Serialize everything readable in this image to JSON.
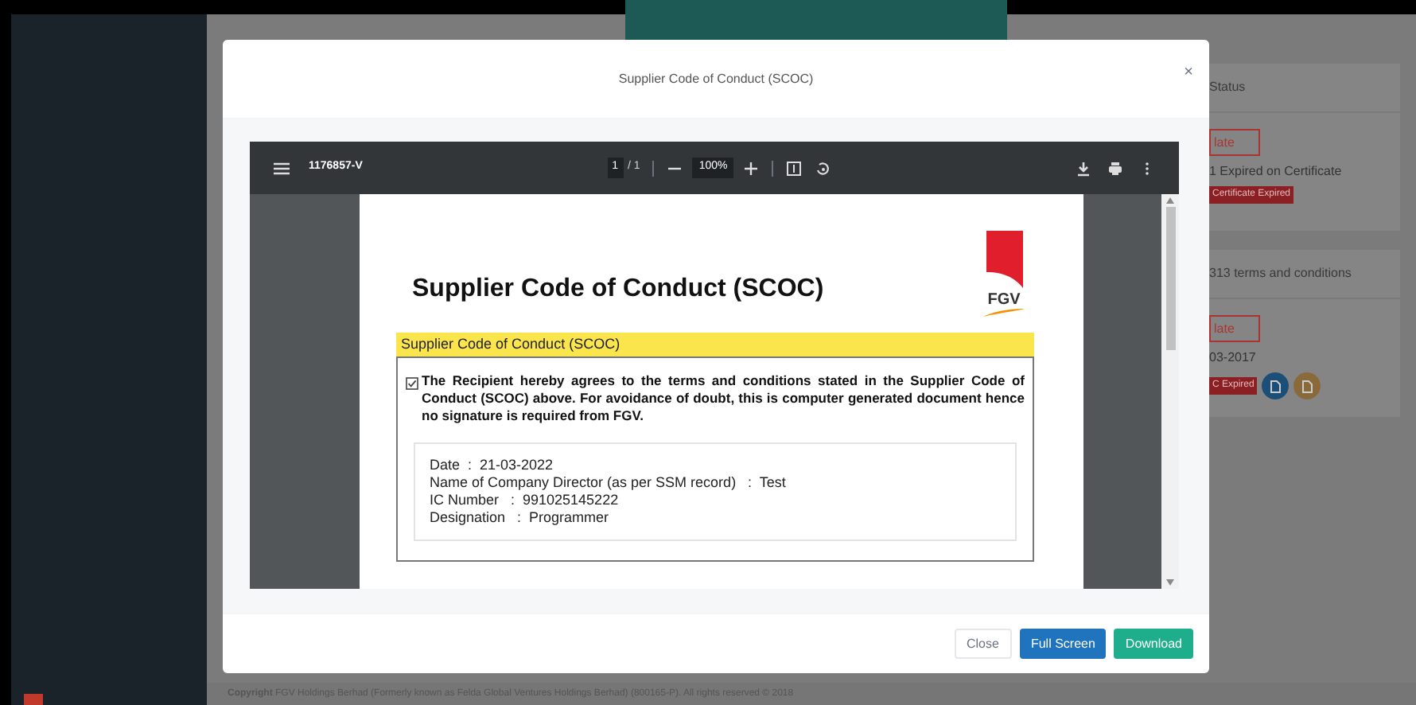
{
  "background": {
    "status_card": {
      "title": "Status",
      "button": "late",
      "note": "1 Expired on Certificate",
      "badge": "Certificate Expired"
    },
    "terms_card": {
      "title": "313 terms and conditions",
      "button": "late",
      "date": "03-2017",
      "badge": "C Expired"
    },
    "copyright": "**Copyright** FGV Holdings Berhad (Formerly known as Felda Global Ventures Holdings Berhad) (800165-P). All rights reserved © 2018"
  },
  "modal": {
    "title": "Supplier Code of Conduct (SCOC)",
    "close": "×",
    "viewer": {
      "file_name": "1176857-V",
      "page": "1",
      "page_count": "/ 1",
      "zoom": "100%"
    },
    "document": {
      "title": "Supplier Code of Conduct (SCOC)",
      "logo_text": "FGV",
      "section_title": "Supplier Code of Conduct (SCOC)",
      "agreement": "The Recipient hereby agrees to the terms and conditions stated in the Supplier Code of Conduct (SCOC) above. For avoidance of doubt, this is computer generated document hence no signature is required from FGV.",
      "agreed": true,
      "details": [
        "Date  :  21-03-2022",
        "Name of Company Director (as per SSM record)   :  Test",
        "IC Number   :  991025145222",
        "Designation   :  Programmer"
      ]
    },
    "buttons": [
      {
        "label": "Close",
        "kind": "default"
      },
      {
        "label": "Full Screen",
        "kind": "primary"
      },
      {
        "label": "Download",
        "kind": "success"
      }
    ]
  }
}
